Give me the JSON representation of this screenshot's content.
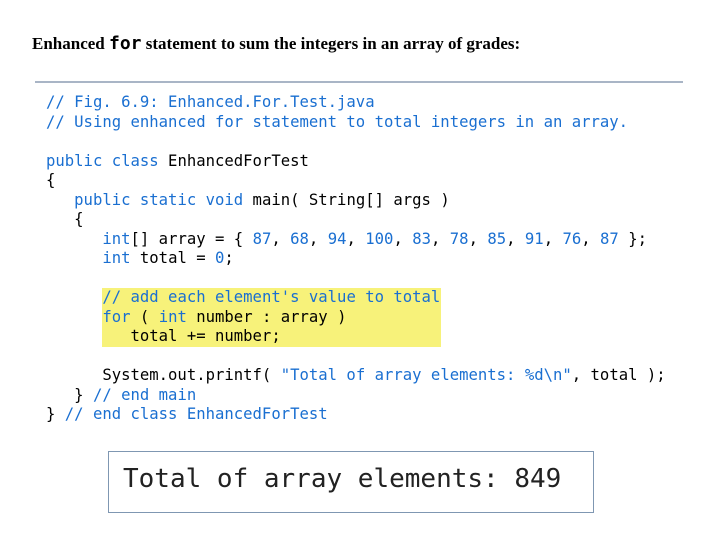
{
  "heading": {
    "prefix": "Enhanced ",
    "keyword": "for",
    "suffix": " statement to sum the integers in an array of  grades:"
  },
  "code_lines": [
    "// Fig. 6.9: Enhanced.For.Test.java",
    "// Using enhanced for statement to total integers in an array.",
    "",
    "public class EnhancedForTest",
    "{",
    "   public static void main( String[] args )",
    "   {",
    "      int[] array = { 87, 68, 94, 100, 83, 78, 85, 91, 76, 87 };",
    "      int total = 0;",
    "",
    "      // add each element's value to total",
    "      for ( int number : array )",
    "         total += number;",
    "",
    "      System.out.printf( \"Total of array elements: %d\\n\", total );",
    "   } // end main",
    "} // end class EnhancedForTest"
  ],
  "output": {
    "text": "Total of array elements: 849"
  }
}
